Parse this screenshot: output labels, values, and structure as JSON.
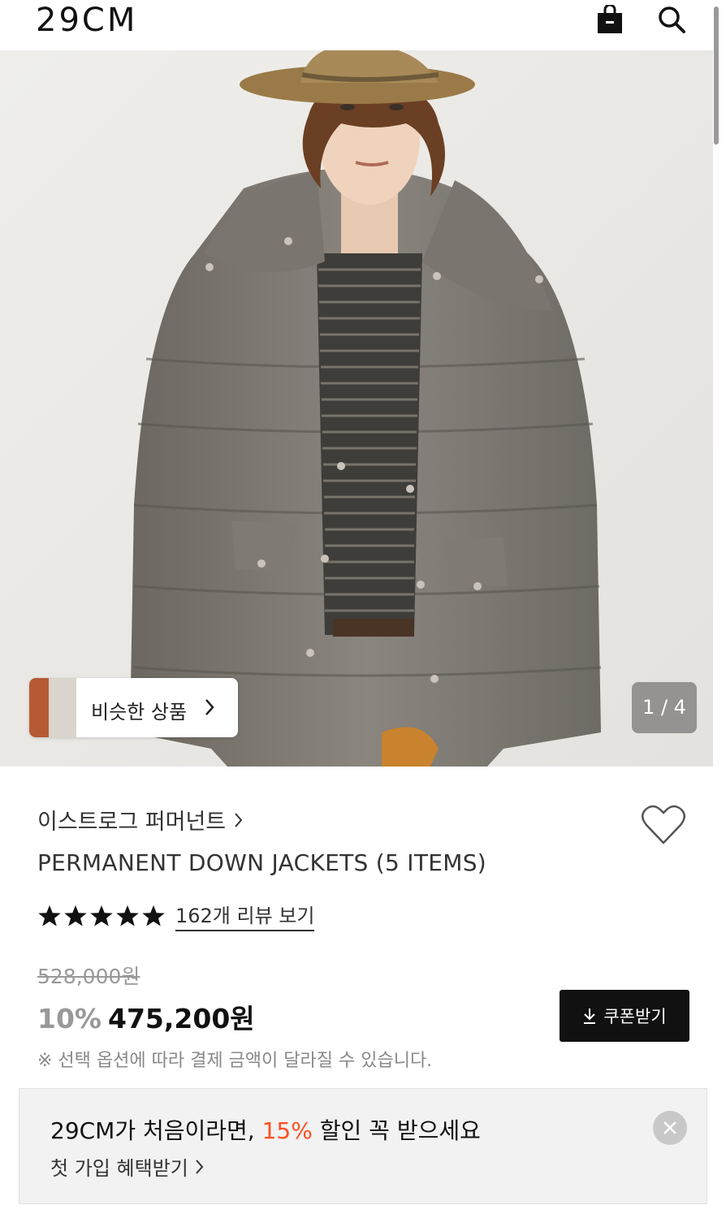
{
  "header": {
    "logo": "29CM",
    "bag_icon": "shopping-bag-icon",
    "search_icon": "search-icon"
  },
  "gallery": {
    "similar_label": "비슷한 상품",
    "counter": "1 / 4"
  },
  "product": {
    "brand": "이스트로그 퍼머넌트",
    "title": "PERMANENT DOWN JACKETS (5 ITEMS)",
    "rating_stars": 5,
    "reviews_link": "162개 리뷰 보기",
    "original_price": "528,000원",
    "discount": "10%",
    "final_price": "475,200원",
    "coupon_label": "쿠폰받기",
    "notice": "※ 선택 옵션에 따라 결제 금액이 달라질 수 있습니다."
  },
  "banner": {
    "headline_prefix": "29CM가 처음이라면, ",
    "headline_highlight": "15%",
    "headline_suffix": " 할인 꼭 받으세요",
    "link": "첫 가입 혜택받기",
    "highlight_color": "#ff4f21"
  }
}
